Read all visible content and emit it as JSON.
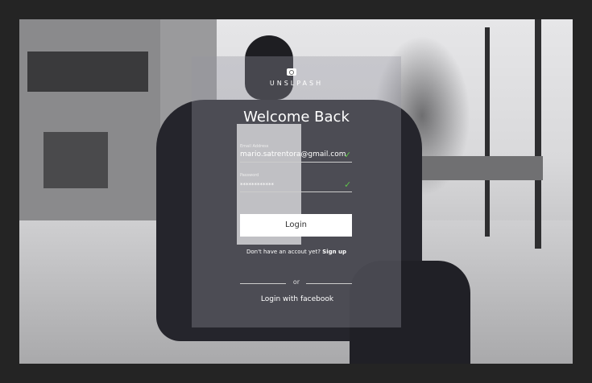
{
  "brand": "UNSLPASH",
  "brand_icon": "camera-icon",
  "title": "Welcome Back",
  "email": {
    "label": "Email Address",
    "value": "mario.satrentora@gmail.com"
  },
  "password": {
    "label": "Password",
    "value": "************"
  },
  "login_label": "Login",
  "signup_prompt": "Don't have an accout yet?",
  "signup_link": "Sign up",
  "or": "or",
  "facebook_label": "Login with facebook",
  "colors": {
    "check": "#5fc24a",
    "frame": "#242424"
  }
}
